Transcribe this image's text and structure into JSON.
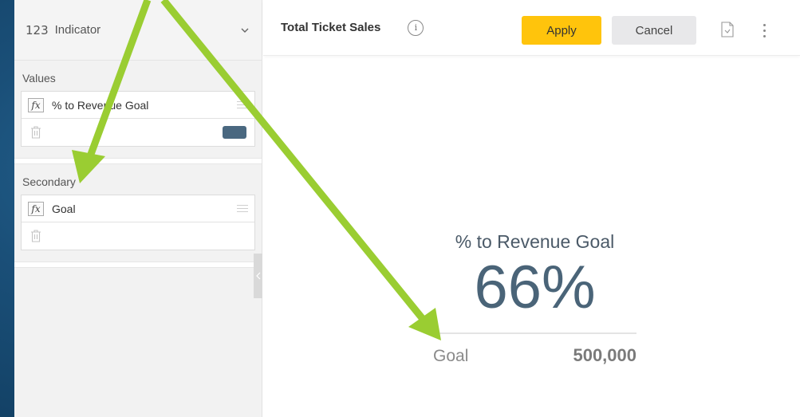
{
  "sidebar": {
    "viz_icon": "123",
    "viz_type": "Indicator",
    "values_section": {
      "title": "Values",
      "field": "% to Revenue Goal",
      "fx_label": "fx"
    },
    "secondary_section": {
      "title": "Secondary",
      "field": "Goal",
      "fx_label": "fx"
    },
    "swatch_color": "#4a6880"
  },
  "header": {
    "title": "Total Ticket Sales",
    "info_icon": "i",
    "apply_label": "Apply",
    "cancel_label": "Cancel"
  },
  "indicator": {
    "label": "% to Revenue Goal",
    "value": "66%",
    "secondary_label": "Goal",
    "secondary_value": "500,000"
  },
  "colors": {
    "accent": "#ffc40c",
    "arrow": "#9acd32",
    "background": "#1a4f78"
  }
}
